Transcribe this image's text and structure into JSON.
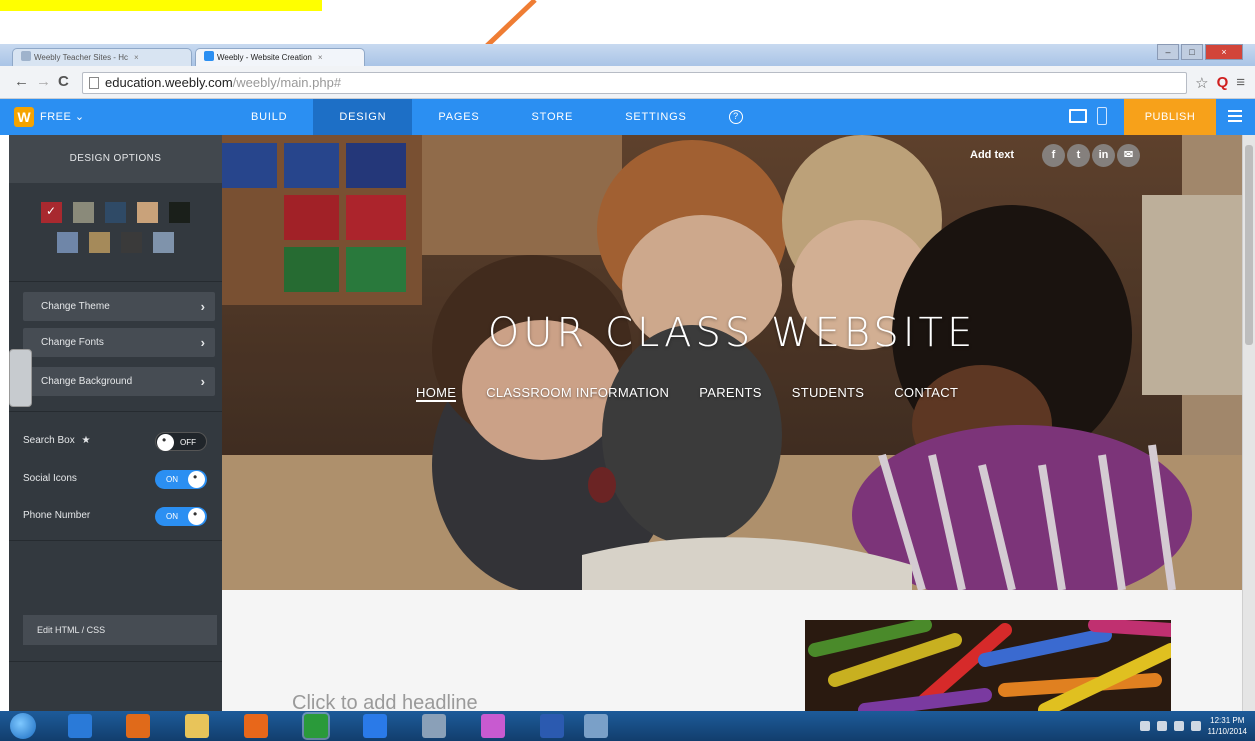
{
  "browser": {
    "tabs": [
      {
        "label": "Weebly Teacher Sites - Hc",
        "active": false
      },
      {
        "label": "Weebly - Website Creation",
        "active": true
      }
    ],
    "url_host": "education.weebly.com",
    "url_path": "/weebly/main.php#"
  },
  "topbar": {
    "plan_label": "FREE ⌄",
    "nav": [
      "BUILD",
      "DESIGN",
      "PAGES",
      "STORE",
      "SETTINGS"
    ],
    "active_nav": "DESIGN",
    "publish_label": "PUBLISH",
    "accent_color": "#2b8ff2",
    "publish_color": "#f7a11a"
  },
  "sidebar": {
    "title": "DESIGN OPTIONS",
    "swatch_colors": [
      "#a8292f",
      "#8a8a7a",
      "#2f4a66",
      "#c9a27a",
      "#1a1f1a",
      "#6f86a8",
      "#a58a5a",
      "#3a3a3a",
      "#7f93ab"
    ],
    "buttons": [
      {
        "label": "Change Theme"
      },
      {
        "label": "Change Fonts"
      },
      {
        "label": "Change Background"
      }
    ],
    "toggles": [
      {
        "label": "Search Box",
        "state": "OFF",
        "star": "★"
      },
      {
        "label": "Social Icons",
        "state": "ON"
      },
      {
        "label": "Phone Number",
        "state": "ON"
      }
    ],
    "edit_html_label": "Edit HTML / CSS"
  },
  "site": {
    "add_text": "Add text",
    "social": [
      "f",
      "t",
      "in",
      "✉"
    ],
    "title": "OUR CLASS WEBSITE",
    "nav": [
      "HOME",
      "CLASSROOM INFORMATION",
      "PARENTS",
      "STUDENTS",
      "CONTACT"
    ],
    "headline_placeholder": "Click to add headline"
  },
  "taskbar": {
    "time": "12:31 PM",
    "date": "11/10/2014"
  }
}
